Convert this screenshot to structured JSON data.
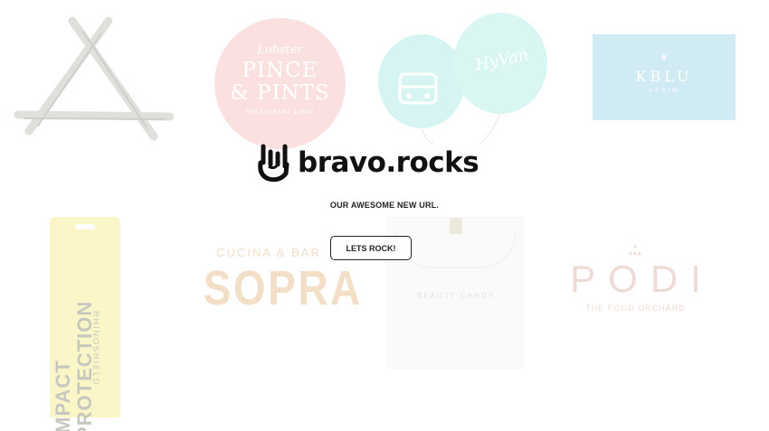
{
  "brand": {
    "name": "bravo.rocks",
    "icon": "rock-hand-icon"
  },
  "tagline": "OUR AWESOME NEW URL.",
  "cta": {
    "label": "LETS ROCK!"
  },
  "portfolio": {
    "lobster": {
      "top": "Lobster",
      "main1": "PINCE",
      "main2": "& PINTS",
      "sub": "RESTAURANT & BAR"
    },
    "hyvan": {
      "label": "HyVan"
    },
    "kblu": {
      "label": "KBLU",
      "sub": "DENIM"
    },
    "impact": {
      "line1": "IMPACT",
      "line2": "PROTECTION",
      "brand": "RHINOSHIELD"
    },
    "sopra": {
      "top": "CUCINA & BAR",
      "main": "SOPRA"
    },
    "beauty": {
      "label": "BEAUTY CANDY"
    },
    "podi": {
      "main": "PODI",
      "sub": "THE FOOD ORCHARD"
    }
  },
  "colors": {
    "background": "#ffffff",
    "text": "#111111",
    "pink": "#f2b8b6",
    "teal": "#9ee6e0",
    "blue": "#8fd0e4",
    "yellow": "#f4ea7a",
    "sopra": "#e3b07a",
    "podi_pink": "#d8a99b"
  }
}
